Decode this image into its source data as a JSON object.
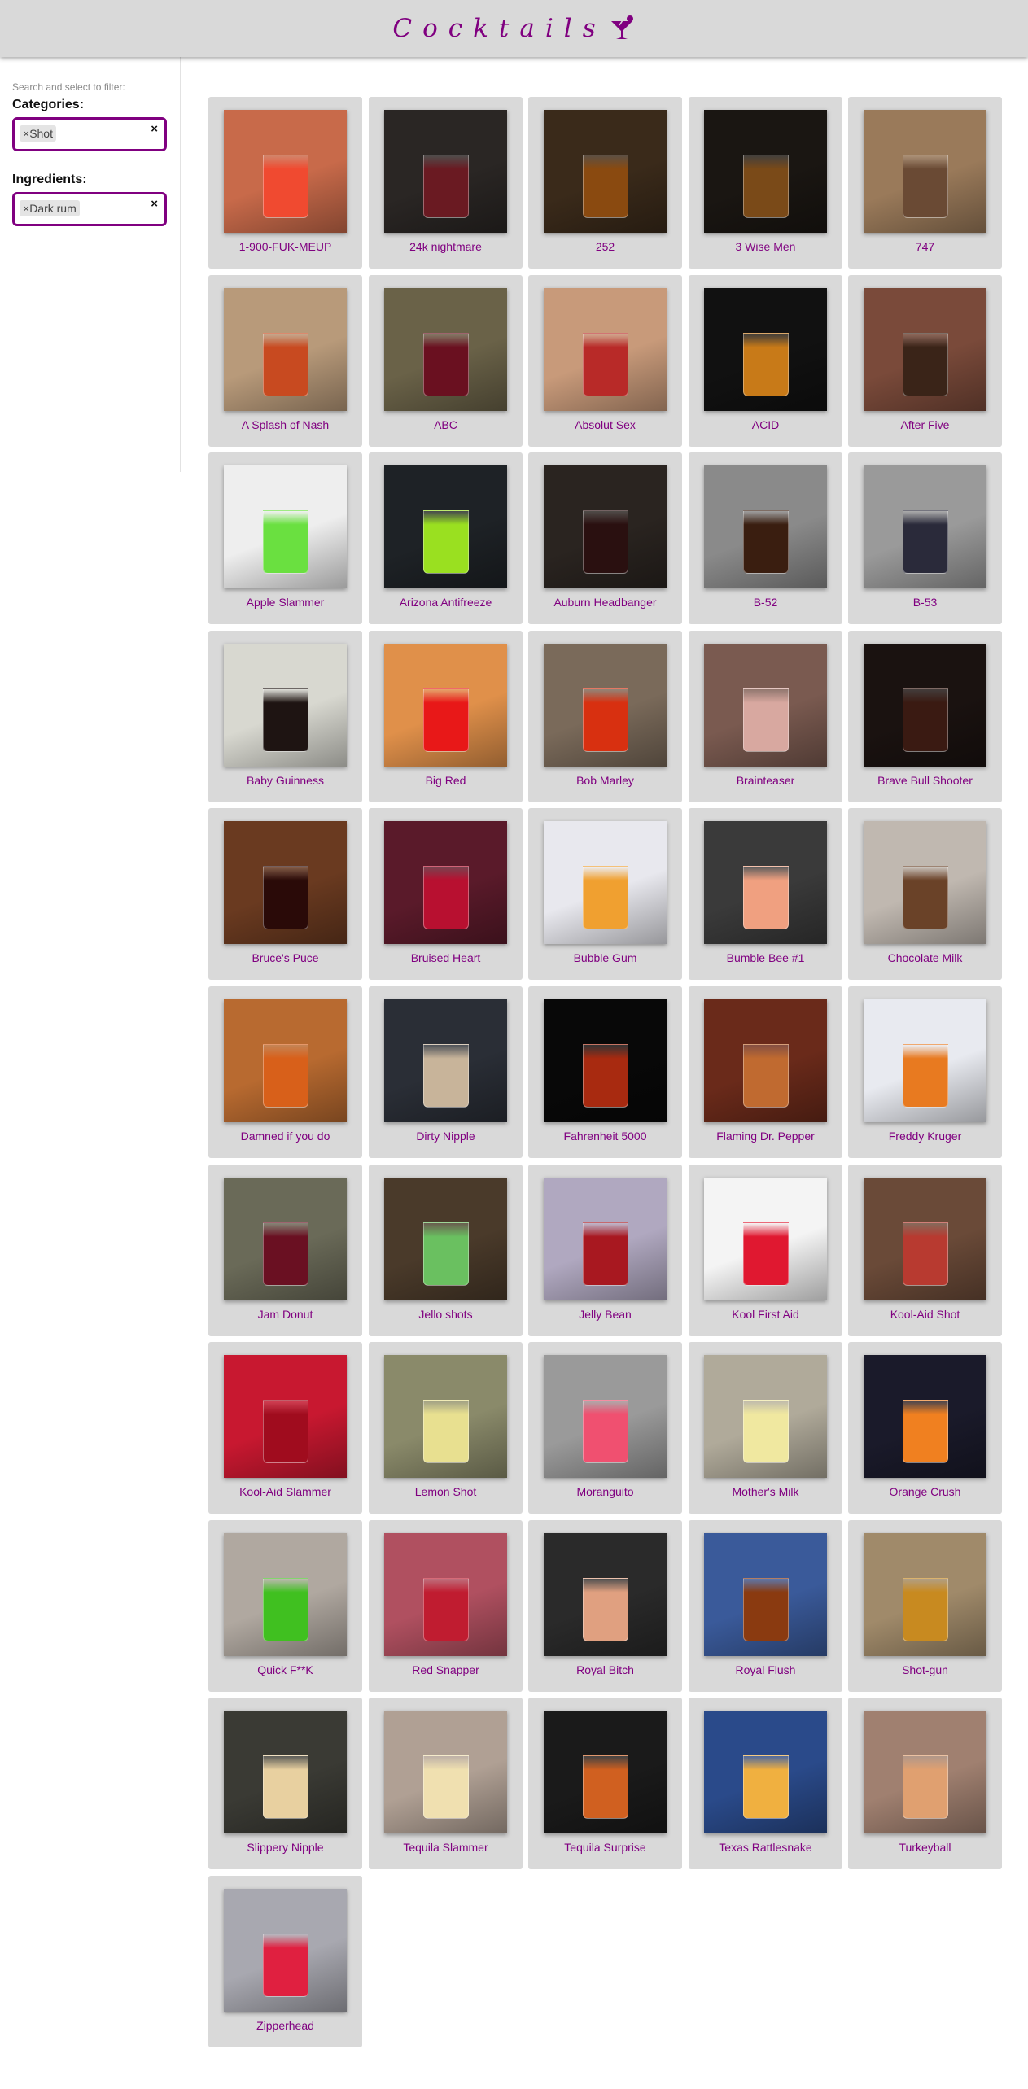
{
  "app": {
    "title": "Cocktails",
    "brand_color": "#800080",
    "icon": "cocktail-glass-icon"
  },
  "sidebar": {
    "hint": "Search and select to filter:",
    "categories": {
      "label": "Categories:",
      "tag": "Shot",
      "tag_remove": "×",
      "clear": "×"
    },
    "ingredients": {
      "label": "Ingredients:",
      "tag": "Dark rum",
      "tag_remove": "×",
      "clear": "×"
    }
  },
  "drinks": [
    {
      "name": "1-900-FUK-MEUP",
      "bg": "#c86a4a",
      "liquid": "#f04a30"
    },
    {
      "name": "24k nightmare",
      "bg": "#2a2624",
      "liquid": "#6a1a22"
    },
    {
      "name": "252",
      "bg": "#3a2a1a",
      "liquid": "#8a4a10"
    },
    {
      "name": "3 Wise Men",
      "bg": "#1a1612",
      "liquid": "#7a4a18"
    },
    {
      "name": "747",
      "bg": "#9a7a5a",
      "liquid": "#6a4a34"
    },
    {
      "name": "A Splash of Nash",
      "bg": "#b89a7a",
      "liquid": "#c84a20"
    },
    {
      "name": "ABC",
      "bg": "#6a6248",
      "liquid": "#6a1020"
    },
    {
      "name": "Absolut Sex",
      "bg": "#c89a7a",
      "liquid": "#b82a28"
    },
    {
      "name": "ACID",
      "bg": "#111111",
      "liquid": "#c87a18"
    },
    {
      "name": "After Five",
      "bg": "#7a4a3a",
      "liquid": "#3a2418"
    },
    {
      "name": "Apple Slammer",
      "bg": "#eeeeee",
      "liquid": "#6ae040"
    },
    {
      "name": "Arizona Antifreeze",
      "bg": "#1e2226",
      "liquid": "#9ae020"
    },
    {
      "name": "Auburn Headbanger",
      "bg": "#2a2420",
      "liquid": "#2a1010"
    },
    {
      "name": "B-52",
      "bg": "#8a8a8a",
      "liquid": "#3a1e10"
    },
    {
      "name": "B-53",
      "bg": "#9a9a9a",
      "liquid": "#2a2a3a"
    },
    {
      "name": "Baby Guinness",
      "bg": "#d8d8d0",
      "liquid": "#1e1412"
    },
    {
      "name": "Big Red",
      "bg": "#e0904a",
      "liquid": "#e81818"
    },
    {
      "name": "Bob Marley",
      "bg": "#7a6a5a",
      "liquid": "#d83010"
    },
    {
      "name": "Brainteaser",
      "bg": "#7a5a50",
      "liquid": "#d8a8a0"
    },
    {
      "name": "Brave Bull Shooter",
      "bg": "#1a1210",
      "liquid": "#3a1a12"
    },
    {
      "name": "Bruce's Puce",
      "bg": "#6a3a20",
      "liquid": "#2a0a08"
    },
    {
      "name": "Bruised Heart",
      "bg": "#5a1a2a",
      "liquid": "#b81030"
    },
    {
      "name": "Bubble Gum",
      "bg": "#e8e8ee",
      "liquid": "#f0a030"
    },
    {
      "name": "Bumble Bee #1",
      "bg": "#3a3a3a",
      "liquid": "#f0a080"
    },
    {
      "name": "Chocolate Milk",
      "bg": "#c0b8b0",
      "liquid": "#6a4228"
    },
    {
      "name": "Damned if you do",
      "bg": "#b86a30",
      "liquid": "#d8601a"
    },
    {
      "name": "Dirty Nipple",
      "bg": "#2a2e36",
      "liquid": "#c8b49a"
    },
    {
      "name": "Fahrenheit 5000",
      "bg": "#080808",
      "liquid": "#a82a10"
    },
    {
      "name": "Flaming Dr. Pepper",
      "bg": "#6a2a1a",
      "liquid": "#c06a30"
    },
    {
      "name": "Freddy Kruger",
      "bg": "#e8eaf0",
      "liquid": "#e87a20"
    },
    {
      "name": "Jam Donut",
      "bg": "#6a6a58",
      "liquid": "#6a1022"
    },
    {
      "name": "Jello shots",
      "bg": "#4a3a2a",
      "liquid": "#6ac060"
    },
    {
      "name": "Jelly Bean",
      "bg": "#b0a8c0",
      "liquid": "#a81820"
    },
    {
      "name": "Kool First Aid",
      "bg": "#f4f4f4",
      "liquid": "#e01830"
    },
    {
      "name": "Kool-Aid Shot",
      "bg": "#6a4a38",
      "liquid": "#b83a30"
    },
    {
      "name": "Kool-Aid Slammer",
      "bg": "#c81830",
      "liquid": "#a00c1e"
    },
    {
      "name": "Lemon Shot",
      "bg": "#8a8a6a",
      "liquid": "#e8e090"
    },
    {
      "name": "Moranguito",
      "bg": "#9a9a9a",
      "liquid": "#f05070"
    },
    {
      "name": "Mother's Milk",
      "bg": "#b0aa9a",
      "liquid": "#f0e8a0"
    },
    {
      "name": "Orange Crush",
      "bg": "#1a1a2a",
      "liquid": "#f08020"
    },
    {
      "name": "Quick F**K",
      "bg": "#b0a8a0",
      "liquid": "#40c020"
    },
    {
      "name": "Red Snapper",
      "bg": "#b05060",
      "liquid": "#c01c30"
    },
    {
      "name": "Royal Bitch",
      "bg": "#2a2a2a",
      "liquid": "#e0a080"
    },
    {
      "name": "Royal Flush",
      "bg": "#3a5a9a",
      "liquid": "#8a3a10"
    },
    {
      "name": "Shot-gun",
      "bg": "#a08a6a",
      "liquid": "#c88a20"
    },
    {
      "name": "Slippery Nipple",
      "bg": "#3a3a34",
      "liquid": "#e8d0a0"
    },
    {
      "name": "Tequila Slammer",
      "bg": "#b0a094",
      "liquid": "#f0e0b0"
    },
    {
      "name": "Tequila Surprise",
      "bg": "#1a1a1a",
      "liquid": "#d06020"
    },
    {
      "name": "Texas Rattlesnake",
      "bg": "#2a4a8a",
      "liquid": "#f0b040"
    },
    {
      "name": "Turkeyball",
      "bg": "#a08070",
      "liquid": "#e0a070"
    },
    {
      "name": "Zipperhead",
      "bg": "#a8a8b0",
      "liquid": "#e02040"
    }
  ]
}
